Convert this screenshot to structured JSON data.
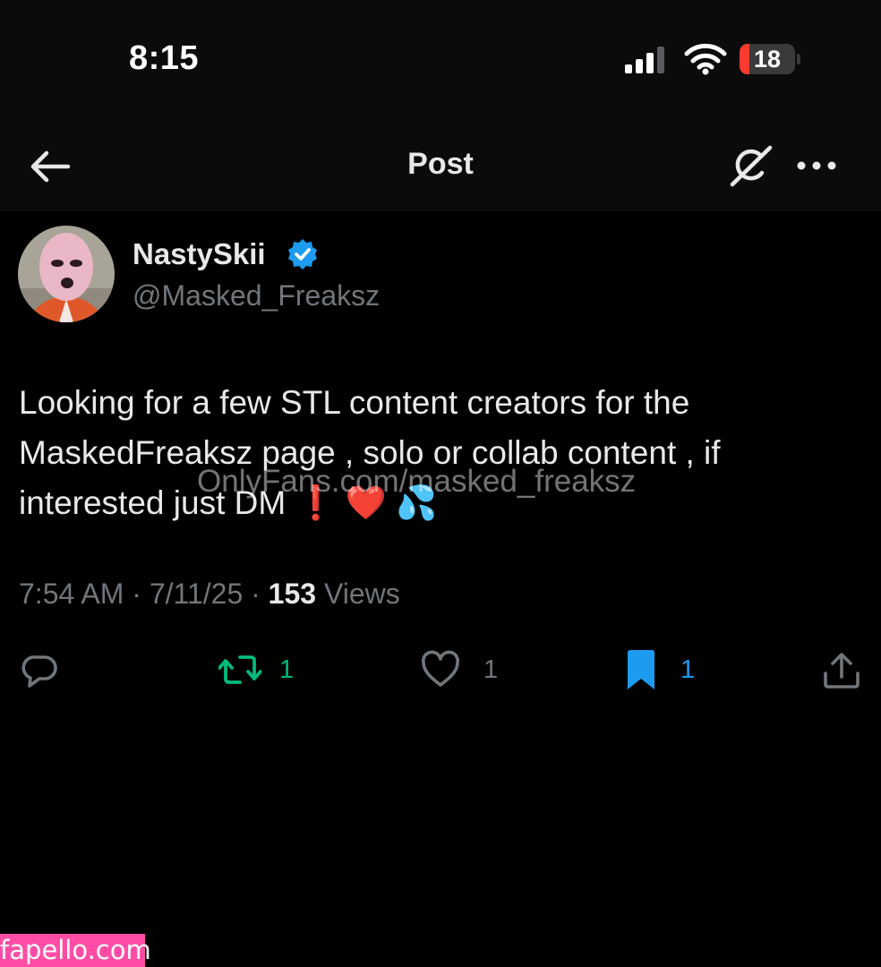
{
  "status_bar": {
    "time": "8:15",
    "battery_level": "18",
    "battery_fraction": 0.18,
    "signal_icon": "cellular-signal-icon",
    "wifi_icon": "wifi-icon"
  },
  "header": {
    "title": "Post",
    "back_icon": "arrow-left-icon",
    "grok_icon": "grok-icon",
    "more_icon": "more-horizontal-icon"
  },
  "author": {
    "display_name": "NastySkii",
    "handle": "@Masked_Freaksz",
    "verified_icon": "verified-badge-icon",
    "verified_color": "#1d9bf0"
  },
  "post": {
    "text": "Looking for a few STL content creators for the MaskedFreaksz page , solo or collab content , if interested just DM",
    "emoji_exclamation": "❗",
    "emoji_heart": "❤️",
    "emoji_drops": "💦",
    "watermark": "OnlyFans.com/masked_freaksz"
  },
  "meta": {
    "time": "7:54 AM",
    "separator": "·",
    "date": "7/11/25",
    "views_count": "153",
    "views_label": "Views"
  },
  "actions": {
    "reply_icon": "reply-icon",
    "repost_icon": "repost-icon",
    "repost_count": "1",
    "repost_color": "#00ba7c",
    "like_icon": "heart-icon",
    "like_count": "1",
    "bookmark_icon": "bookmark-icon",
    "bookmark_count": "1",
    "bookmark_color": "#1d9bf0",
    "share_icon": "share-icon"
  },
  "footer": {
    "site_badge": "fapello.com"
  }
}
